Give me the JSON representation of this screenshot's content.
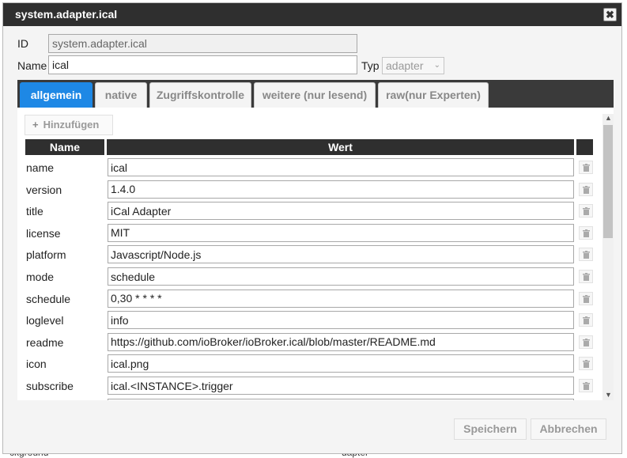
{
  "background": {
    "left_partial": "ckground",
    "right_partial": "dapter"
  },
  "dialog": {
    "title": "system.adapter.ical",
    "close_glyph": "✖"
  },
  "form": {
    "id_label": "ID",
    "id_value": "system.adapter.ical",
    "name_label": "Name",
    "name_value": "ical",
    "type_label": "Typ",
    "type_value": "adapter"
  },
  "tabs": [
    {
      "label": "allgemein",
      "active": true
    },
    {
      "label": "native",
      "active": false
    },
    {
      "label": "Zugriffskontrolle",
      "active": false
    },
    {
      "label": "weitere (nur lesend)",
      "active": false
    },
    {
      "label": "raw(nur Experten)",
      "active": false
    }
  ],
  "table": {
    "add_label": "Hinzufügen",
    "col_name": "Name",
    "col_value": "Wert",
    "rows": [
      {
        "key": "name",
        "value": "ical"
      },
      {
        "key": "version",
        "value": "1.4.0"
      },
      {
        "key": "title",
        "value": "iCal Adapter"
      },
      {
        "key": "license",
        "value": "MIT"
      },
      {
        "key": "platform",
        "value": "Javascript/Node.js"
      },
      {
        "key": "mode",
        "value": "schedule"
      },
      {
        "key": "schedule",
        "value": "0,30 * * * *"
      },
      {
        "key": "loglevel",
        "value": "info"
      },
      {
        "key": "readme",
        "value": "https://github.com/ioBroker/ioBroker.ical/blob/master/README.md"
      },
      {
        "key": "icon",
        "value": "ical.png"
      },
      {
        "key": "subscribe",
        "value": "ical.<INSTANCE>.trigger"
      },
      {
        "key": "",
        "value": ""
      }
    ]
  },
  "footer": {
    "save_label": "Speichern",
    "cancel_label": "Abbrechen"
  },
  "colors": {
    "titlebar": "#2f2f2f",
    "active_tab": "#1e88e5",
    "tabbar": "#3a3a3a"
  }
}
